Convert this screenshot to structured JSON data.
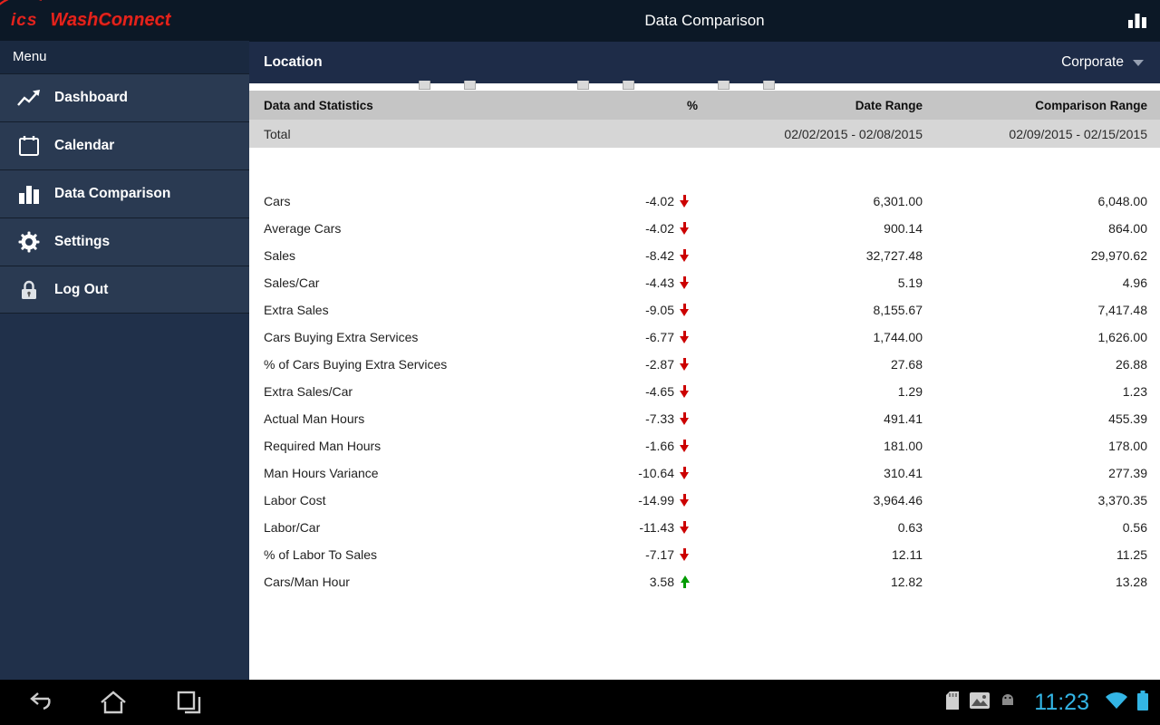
{
  "app": {
    "logo_ics": "ics",
    "logo_name": "WashConnect",
    "menu_label": "Menu",
    "title": "Data Comparison"
  },
  "sidebar": {
    "items": [
      {
        "label": "Dashboard",
        "icon": "line-chart-icon"
      },
      {
        "label": "Calendar",
        "icon": "calendar-icon"
      },
      {
        "label": "Data Comparison",
        "icon": "bar-chart-icon"
      },
      {
        "label": "Settings",
        "icon": "gear-icon"
      },
      {
        "label": "Log Out",
        "icon": "lock-icon"
      }
    ]
  },
  "location_bar": {
    "label": "Location",
    "selected": "Corporate"
  },
  "table": {
    "headers": [
      "Data and Statistics",
      "%",
      "Date Range",
      "Comparison Range"
    ],
    "total": {
      "name": "Total",
      "date_range": "02/02/2015 - 02/08/2015",
      "comparison_range": "02/09/2015 - 02/15/2015"
    },
    "rows": [
      {
        "name": "Cars",
        "pct": "-4.02",
        "trend": "down",
        "value": "6,301.00",
        "comparison": "6,048.00"
      },
      {
        "name": "Average Cars",
        "pct": "-4.02",
        "trend": "down",
        "value": "900.14",
        "comparison": "864.00"
      },
      {
        "name": "Sales",
        "pct": "-8.42",
        "trend": "down",
        "value": "32,727.48",
        "comparison": "29,970.62"
      },
      {
        "name": "Sales/Car",
        "pct": "-4.43",
        "trend": "down",
        "value": "5.19",
        "comparison": "4.96"
      },
      {
        "name": "Extra Sales",
        "pct": "-9.05",
        "trend": "down",
        "value": "8,155.67",
        "comparison": "7,417.48"
      },
      {
        "name": "Cars Buying Extra Services",
        "pct": "-6.77",
        "trend": "down",
        "value": "1,744.00",
        "comparison": "1,626.00"
      },
      {
        "name": "% of Cars Buying Extra Services",
        "pct": "-2.87",
        "trend": "down",
        "value": "27.68",
        "comparison": "26.88"
      },
      {
        "name": "Extra Sales/Car",
        "pct": "-4.65",
        "trend": "down",
        "value": "1.29",
        "comparison": "1.23"
      },
      {
        "name": "Actual Man Hours",
        "pct": "-7.33",
        "trend": "down",
        "value": "491.41",
        "comparison": "455.39"
      },
      {
        "name": "Required Man Hours",
        "pct": "-1.66",
        "trend": "down",
        "value": "181.00",
        "comparison": "178.00"
      },
      {
        "name": "Man Hours Variance",
        "pct": "-10.64",
        "trend": "down",
        "value": "310.41",
        "comparison": "277.39"
      },
      {
        "name": "Labor Cost",
        "pct": "-14.99",
        "trend": "down",
        "value": "3,964.46",
        "comparison": "3,370.35"
      },
      {
        "name": "Labor/Car",
        "pct": "-11.43",
        "trend": "down",
        "value": "0.63",
        "comparison": "0.56"
      },
      {
        "name": "% of Labor To Sales",
        "pct": "-7.17",
        "trend": "down",
        "value": "12.11",
        "comparison": "11.25"
      },
      {
        "name": "Cars/Man Hour",
        "pct": "3.58",
        "trend": "up",
        "value": "12.82",
        "comparison": "13.28"
      }
    ]
  },
  "status_bar": {
    "time": "11:23"
  },
  "colors": {
    "accent": "#33b5e5",
    "down": "#cc0000",
    "up": "#009b00",
    "logo": "#e3231d"
  }
}
